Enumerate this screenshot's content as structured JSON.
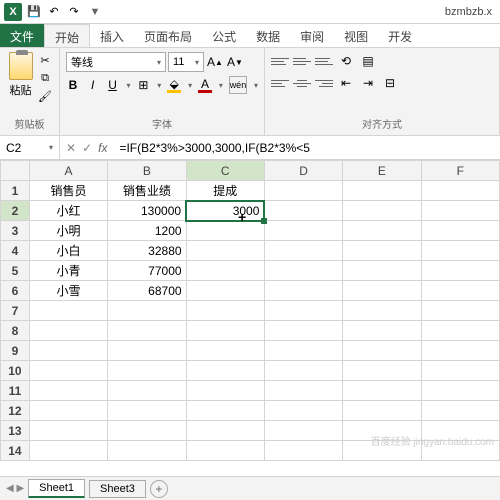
{
  "title_filename": "bzmbzb.x",
  "qat": {
    "save": "💾",
    "undo": "↶",
    "redo": "↷"
  },
  "tabs": {
    "file": "文件",
    "home": "开始",
    "insert": "插入",
    "layout": "页面布局",
    "formula": "公式",
    "data": "数据",
    "review": "审阅",
    "view": "视图",
    "dev": "开发"
  },
  "ribbon": {
    "paste_label": "粘贴",
    "clipboard_group": "剪贴板",
    "font_name": "等线",
    "font_size": "11",
    "font_group": "字体",
    "wen_label": "wén",
    "align_group": "对齐方式"
  },
  "formula_bar": {
    "name_box": "C2",
    "formula": "=IF(B2*3%>3000,3000,IF(B2*3%<5"
  },
  "columns": [
    "A",
    "B",
    "C",
    "D",
    "E",
    "F"
  ],
  "rows": [
    {
      "n": 1,
      "a": "销售员",
      "b": "销售业绩",
      "c": "提成"
    },
    {
      "n": 2,
      "a": "小红",
      "b": "130000",
      "c": "3000"
    },
    {
      "n": 3,
      "a": "小明",
      "b": "1200",
      "c": ""
    },
    {
      "n": 4,
      "a": "小白",
      "b": "32880",
      "c": ""
    },
    {
      "n": 5,
      "a": "小青",
      "b": "77000",
      "c": ""
    },
    {
      "n": 6,
      "a": "小雪",
      "b": "68700",
      "c": ""
    },
    {
      "n": 7,
      "a": "",
      "b": "",
      "c": ""
    },
    {
      "n": 8,
      "a": "",
      "b": "",
      "c": ""
    },
    {
      "n": 9,
      "a": "",
      "b": "",
      "c": ""
    },
    {
      "n": 10,
      "a": "",
      "b": "",
      "c": ""
    },
    {
      "n": 11,
      "a": "",
      "b": "",
      "c": ""
    },
    {
      "n": 12,
      "a": "",
      "b": "",
      "c": ""
    },
    {
      "n": 13,
      "a": "",
      "b": "",
      "c": ""
    },
    {
      "n": 14,
      "a": "",
      "b": "",
      "c": ""
    }
  ],
  "selected": {
    "row": 2,
    "col": "C"
  },
  "sheets": {
    "s1": "Sheet1",
    "s3": "Sheet3",
    "add": "+"
  },
  "watermark": "百度经验 jingyan.baidu.com"
}
